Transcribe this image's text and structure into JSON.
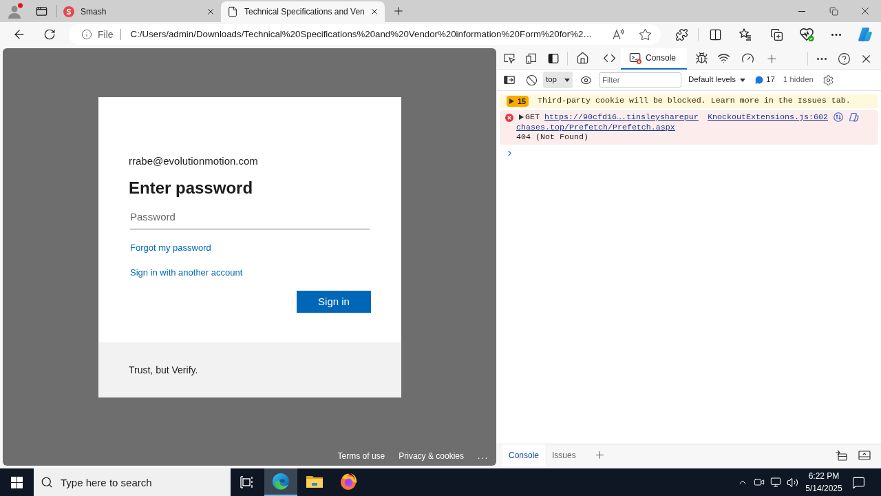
{
  "browser": {
    "tabs": [
      {
        "title": "Smash",
        "selected": false
      },
      {
        "title": "Technical Specifications and Ven",
        "selected": true
      }
    ],
    "address": {
      "scheme": "File",
      "url": "C:/Users/admin/Downloads/Technical%20Specifications%20and%20Vendor%20information%20Form%20for%2…"
    }
  },
  "page": {
    "email": "rrabe@evolutionmotion.com",
    "heading": "Enter password",
    "password": {
      "placeholder": "Password"
    },
    "links": [
      "Forgot my password",
      "Sign in with another account"
    ],
    "submit": "Sign in",
    "tagline": "Trust, but Verify.",
    "footer_links": [
      "Terms of use",
      "Privacy & cookies"
    ],
    "footer_more": "..."
  },
  "devtools": {
    "panel_tabs": [
      {
        "selected": false
      },
      {
        "selected": false
      },
      {
        "label": "Console",
        "selected": true
      },
      {
        "selected": false
      },
      {
        "selected": false
      },
      {
        "selected": false
      }
    ],
    "context": "top",
    "filter": {
      "placeholder": "Filter"
    },
    "levels": "Default levels",
    "message_count": "17",
    "hidden": "1 hidden",
    "messages": [
      {
        "kind": "warning",
        "expanded": false,
        "count": "15",
        "text": "Third-party cookie will be blocked. Learn more in the Issues tab."
      },
      {
        "kind": "error",
        "expanded": false,
        "method": "GET",
        "url": "https://90cfd16….tinsleysharepurchases.top/Prefetch/Prefetch.aspx",
        "status": "404 (Not Found)",
        "source": "KnockoutExtensions.js:602"
      }
    ],
    "drawer_tabs": [
      {
        "label": "Console",
        "selected": true
      },
      {
        "label": "Issues",
        "selected": false
      }
    ]
  },
  "taskbar": {
    "search": {
      "placeholder": "Type here to search"
    },
    "apps": [
      {
        "selected": true
      },
      {
        "selected": false
      },
      {
        "selected": false
      }
    ],
    "time": "6:22 PM",
    "date": "5/14/2025"
  }
}
